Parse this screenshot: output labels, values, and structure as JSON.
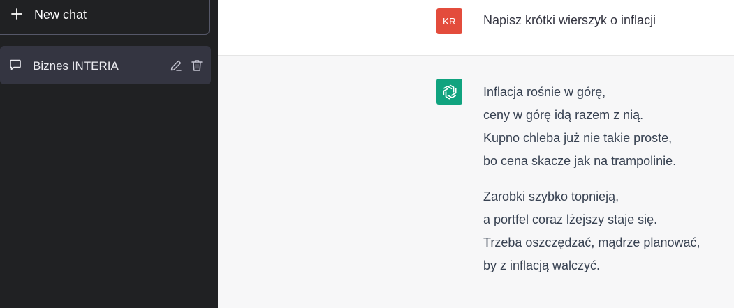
{
  "sidebar": {
    "new_chat_label": "New chat",
    "conversations": [
      {
        "title": "Biznes INTERIA"
      }
    ]
  },
  "conversation": {
    "user": {
      "avatar_initials": "KR",
      "avatar_color": "#e34c3c",
      "message": "Napisz krótki wierszyk o inflacji"
    },
    "assistant": {
      "avatar_icon": "openai-logo-icon",
      "avatar_color": "#10a37f",
      "stanzas": [
        {
          "lines": [
            "Inflacja rośnie w górę,",
            "ceny w górę idą razem z nią.",
            "Kupno chleba już nie takie proste,",
            "bo cena skacze jak na trampolinie."
          ]
        },
        {
          "lines": [
            "Zarobki szybko topnieją,",
            "a portfel coraz lżejszy staje się.",
            "Trzeba oszczędzać, mądrze planować,",
            "by z inflacją walczyć."
          ]
        }
      ]
    }
  },
  "colors": {
    "sidebar_bg": "#202123",
    "sidebar_active_bg": "#343541",
    "main_bg": "#f7f7f8",
    "user_row_bg": "#ffffff",
    "text": "#374151"
  }
}
